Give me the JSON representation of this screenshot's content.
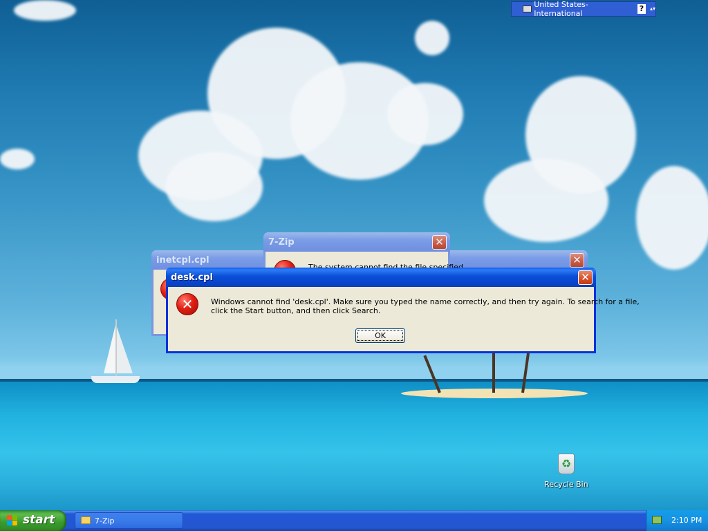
{
  "language_bar": {
    "language": "United States-International",
    "help_glyph": "?",
    "menu_glyph": "▴▾",
    "icon": "keyboard-icon"
  },
  "windows": {
    "inetcpl": {
      "title": "inetcpl.cpl",
      "close_glyph": "✕"
    },
    "sevenzip": {
      "title": "7-Zip",
      "message": "The system cannot find the file specified.",
      "close_glyph": "✕"
    },
    "third": {
      "close_glyph": "✕"
    },
    "desk": {
      "title": "desk.cpl",
      "message_line1": "Windows cannot find 'desk.cpl'. Make sure you typed the name correctly, and then try again. To search for a file,",
      "message_line2": "click the Start button, and then click Search.",
      "ok_label": "OK",
      "close_glyph": "✕",
      "icon": "error-icon",
      "icon_glyph": "✕"
    }
  },
  "desktop_icons": {
    "recycle_bin": {
      "label": "Recycle Bin",
      "glyph": "♻"
    }
  },
  "taskbar": {
    "start_label": "start",
    "tasks": [
      {
        "label": "7-Zip",
        "icon": "folder-icon"
      }
    ],
    "clock": "2:10 PM"
  },
  "colors": {
    "active_title": "#0a4fd7",
    "inactive_title": "#7b9ce6",
    "taskbar": "#2456cf",
    "start_green": "#399a2e",
    "dialog_bg": "#ece9d8"
  }
}
